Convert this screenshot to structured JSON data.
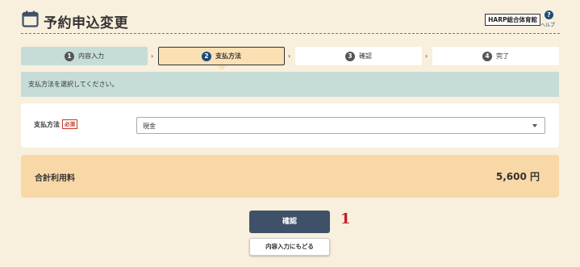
{
  "header": {
    "title": "予約申込変更",
    "facility": "HARP総合体育館",
    "help_label": "ヘルプ",
    "help_symbol": "?"
  },
  "steps": [
    {
      "number": "1",
      "label": "内容入力",
      "state": "done"
    },
    {
      "number": "2",
      "label": "支払方法",
      "state": "current"
    },
    {
      "number": "3",
      "label": "確認",
      "state": "pending"
    },
    {
      "number": "4",
      "label": "完了",
      "state": "pending"
    }
  ],
  "separator": "›",
  "info": {
    "message": "支払方法を選択してください。"
  },
  "form": {
    "payment_label": "支払方法",
    "required_badge": "必須",
    "payment_value": "現金"
  },
  "total": {
    "label": "合計利用料",
    "value": "5,600 円"
  },
  "buttons": {
    "confirm": "確認",
    "back": "内容入力にもどる"
  },
  "annotation": {
    "marker": "1"
  },
  "colors": {
    "background": "#f8efdc",
    "step_done": "#c6ddd7",
    "step_current": "#fbe0b4",
    "total_bg": "#f9d8a7",
    "primary_button": "#3e5168",
    "required": "#c0392b"
  }
}
